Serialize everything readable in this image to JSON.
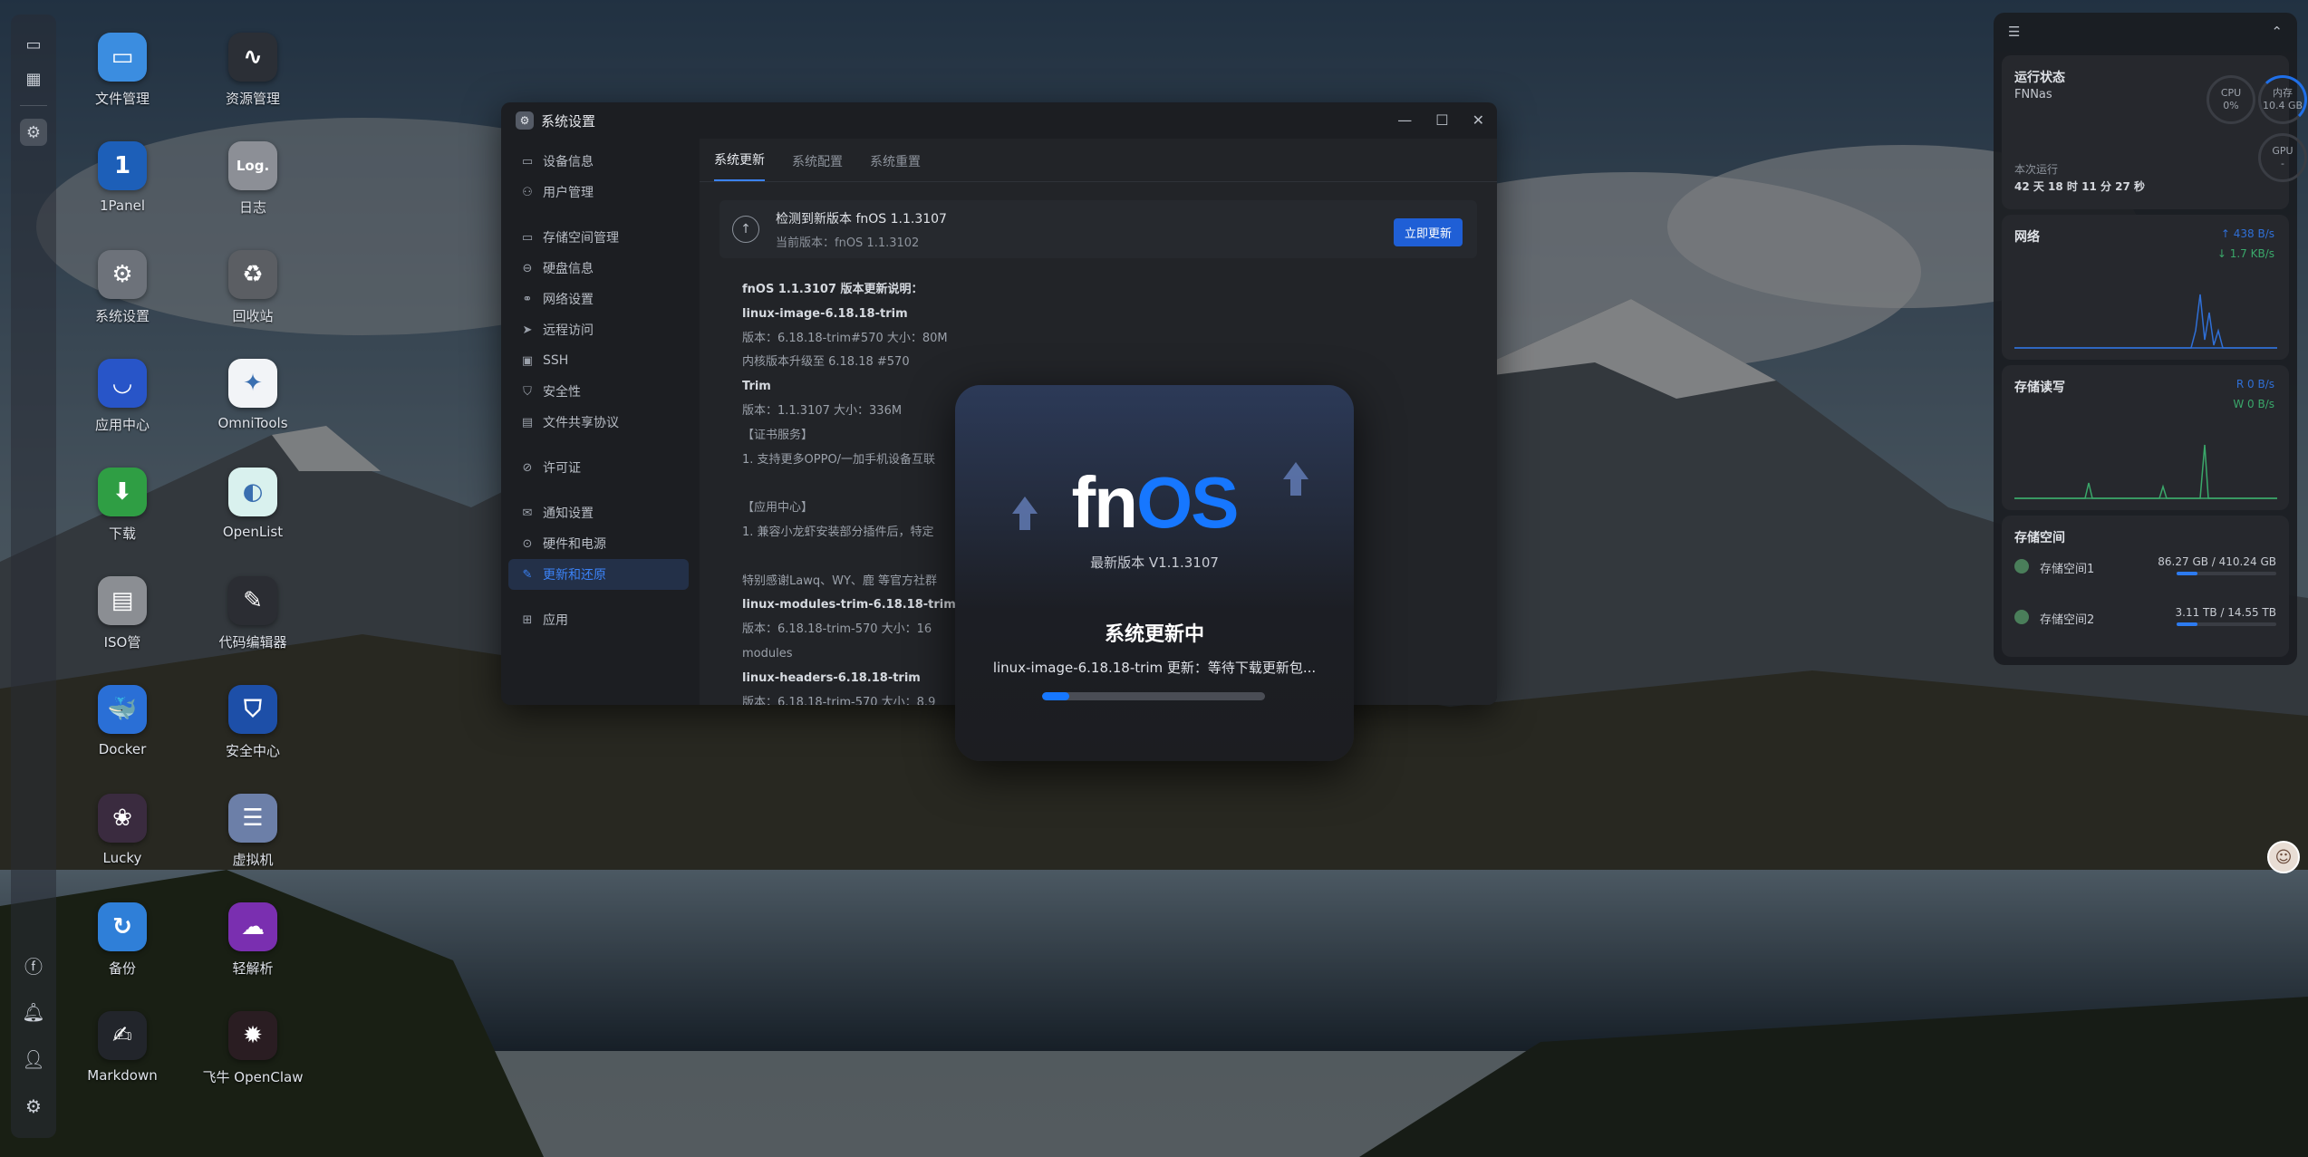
{
  "desktop": {
    "icons": [
      {
        "label": "文件管理",
        "glyph": "▭",
        "color": "#3b8de0"
      },
      {
        "label": "资源管理",
        "glyph": "∿",
        "color": "#2b2f36"
      },
      {
        "label": "1Panel",
        "glyph": "1",
        "color": "#1d5fb8"
      },
      {
        "label": "日志",
        "glyph": "Log.",
        "color": "#8c8f96"
      },
      {
        "label": "系统设置",
        "glyph": "⚙",
        "color": "#6d727a"
      },
      {
        "label": "回收站",
        "glyph": "♻",
        "color": "#5b5e63"
      },
      {
        "label": "应用中心",
        "glyph": "◡",
        "color": "#2855c8"
      },
      {
        "label": "OmniTools",
        "glyph": "✦",
        "color": "#f2f4f7"
      },
      {
        "label": "下载",
        "glyph": "⬇",
        "color": "#2f9e44"
      },
      {
        "label": "OpenList",
        "glyph": "◐",
        "color": "#d9f1ee"
      },
      {
        "label": "ISO管",
        "glyph": "▤",
        "color": "#8b8e93"
      },
      {
        "label": "代码编辑器",
        "glyph": "✎",
        "color": "#2b2d33"
      },
      {
        "label": "Docker",
        "glyph": "🐳",
        "color": "#2a6fd6"
      },
      {
        "label": "安全中心",
        "glyph": "⛉",
        "color": "#1d4fa8"
      },
      {
        "label": "Lucky",
        "glyph": "❀",
        "color": "#3a2b3f"
      },
      {
        "label": "虚拟机",
        "glyph": "☰",
        "color": "#6c7fa8"
      },
      {
        "label": "备份",
        "glyph": "↻",
        "color": "#2f7fd8"
      },
      {
        "label": "轻解析",
        "glyph": "☁",
        "color": "#7a2fb0"
      },
      {
        "label": "Markdown",
        "glyph": "✍",
        "color": "#22252b"
      },
      {
        "label": "飞牛 OpenClaw",
        "glyph": "✹",
        "color": "#2a1d22"
      }
    ]
  },
  "settings_window": {
    "title": "系统设置",
    "controls": {
      "minimize": "—",
      "maximize": "☐",
      "close": "✕"
    },
    "sidebar": [
      {
        "label": "设备信息",
        "icon": "▭"
      },
      {
        "label": "用户管理",
        "icon": "⚇"
      },
      {
        "label": "存储空间管理",
        "icon": "▭"
      },
      {
        "label": "硬盘信息",
        "icon": "⊖"
      },
      {
        "label": "网络设置",
        "icon": "⚭"
      },
      {
        "label": "远程访问",
        "icon": "➤"
      },
      {
        "label": "SSH",
        "icon": "▣"
      },
      {
        "label": "安全性",
        "icon": "⛉"
      },
      {
        "label": "文件共享协议",
        "icon": "▤"
      },
      {
        "label": "许可证",
        "icon": "⊘"
      },
      {
        "label": "通知设置",
        "icon": "✉"
      },
      {
        "label": "硬件和电源",
        "icon": "⊙"
      },
      {
        "label": "更新和还原",
        "icon": "✎"
      },
      {
        "label": "应用",
        "icon": "⊞"
      }
    ],
    "tabs": [
      "系统更新",
      "系统配置",
      "系统重置"
    ],
    "update_card": {
      "icon": "↑",
      "title": "检测到新版本 fnOS 1.1.3107",
      "current": "当前版本：fnOS 1.1.3102",
      "button": "立即更新"
    },
    "notes": [
      "fnOS 1.1.3107 版本更新说明：",
      "linux-image-6.18.18-trim",
      "版本：6.18.18-trim#570      大小：80M",
      "内核版本升级至 6.18.18 #570",
      "Trim",
      "版本：1.1.3107      大小：336M",
      "【证书服务】",
      "1. 支持更多OPPO/一加手机设备互联",
      "",
      "【应用中心】",
      "1. 兼容小龙虾安装部分插件后，特定",
      "",
      "特别感谢Lawq、WY、鹿 等官方社群",
      "linux-modules-trim-6.18.18-trim",
      "版本：6.18.18-trim-570      大小：16",
      "modules",
      "linux-headers-6.18.18-trim",
      "版本：6.18.18-trim-570      大小：8.9"
    ]
  },
  "update_modal": {
    "brand_fn": "fn",
    "brand_os": "OS",
    "version": "最新版本 V1.1.3107",
    "heading": "系统更新中",
    "status": "linux-image-6.18.18-trim  更新：等待下载更新包...",
    "progress": 0.12
  },
  "widgets": {
    "header_left_icon": "☰",
    "header_right_icon": "⌃",
    "status": {
      "title": "运行状态",
      "host": "FNNas",
      "cpu_label": "CPU",
      "cpu_value": "0%",
      "mem_label": "内存",
      "mem_value": "10.4 GB",
      "gpu_label": "GPU",
      "gpu_value": "-",
      "uptime_label": "本次运行",
      "uptime_value": "42 天 18 时 11 分 27 秒"
    },
    "network": {
      "title": "网络",
      "up": "↑ 438 B/s",
      "down": "↓ 1.7 KB/s"
    },
    "disk_io": {
      "title": "存储读写",
      "read": "R 0 B/s",
      "write": "W 0 B/s"
    },
    "storage": {
      "title": "存储空间",
      "volumes": [
        {
          "name": "存储空间1",
          "size": "86.27 GB / 410.24 GB",
          "usage": 0.21
        },
        {
          "name": "存储空间2",
          "size": "3.11 TB / 14.55 TB",
          "usage": 0.21
        }
      ]
    }
  },
  "colors": {
    "accent": "#1677ff",
    "active_nav": "#3b82f6",
    "network_up": "#2f6fd6",
    "network_down": "#3aa86a"
  }
}
